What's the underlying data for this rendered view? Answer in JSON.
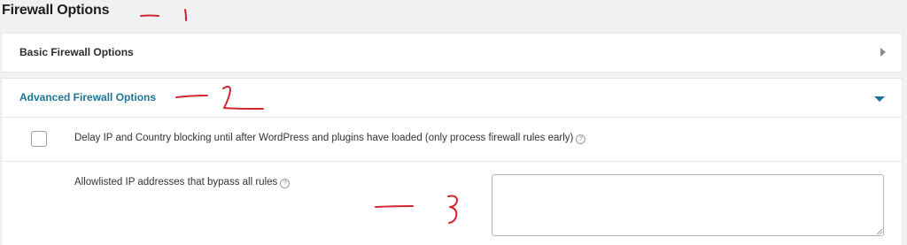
{
  "page": {
    "title": "Firewall Options"
  },
  "basic_panel": {
    "title": "Basic Firewall Options",
    "expanded": false
  },
  "advanced_panel": {
    "title": "Advanced Firewall Options",
    "expanded": true,
    "accent_color": "#1e7493",
    "delay_option": {
      "label": "Delay IP and Country blocking until after WordPress and plugins have loaded (only process firewall rules early)",
      "checked": false,
      "help_icon": "?"
    },
    "allowlist_option": {
      "label": "Allowlisted IP addresses that bypass all rules",
      "help_icon": "?",
      "value": ""
    }
  },
  "annotations": {
    "color": "#d0262d",
    "items": [
      "1",
      "2",
      "3"
    ]
  }
}
